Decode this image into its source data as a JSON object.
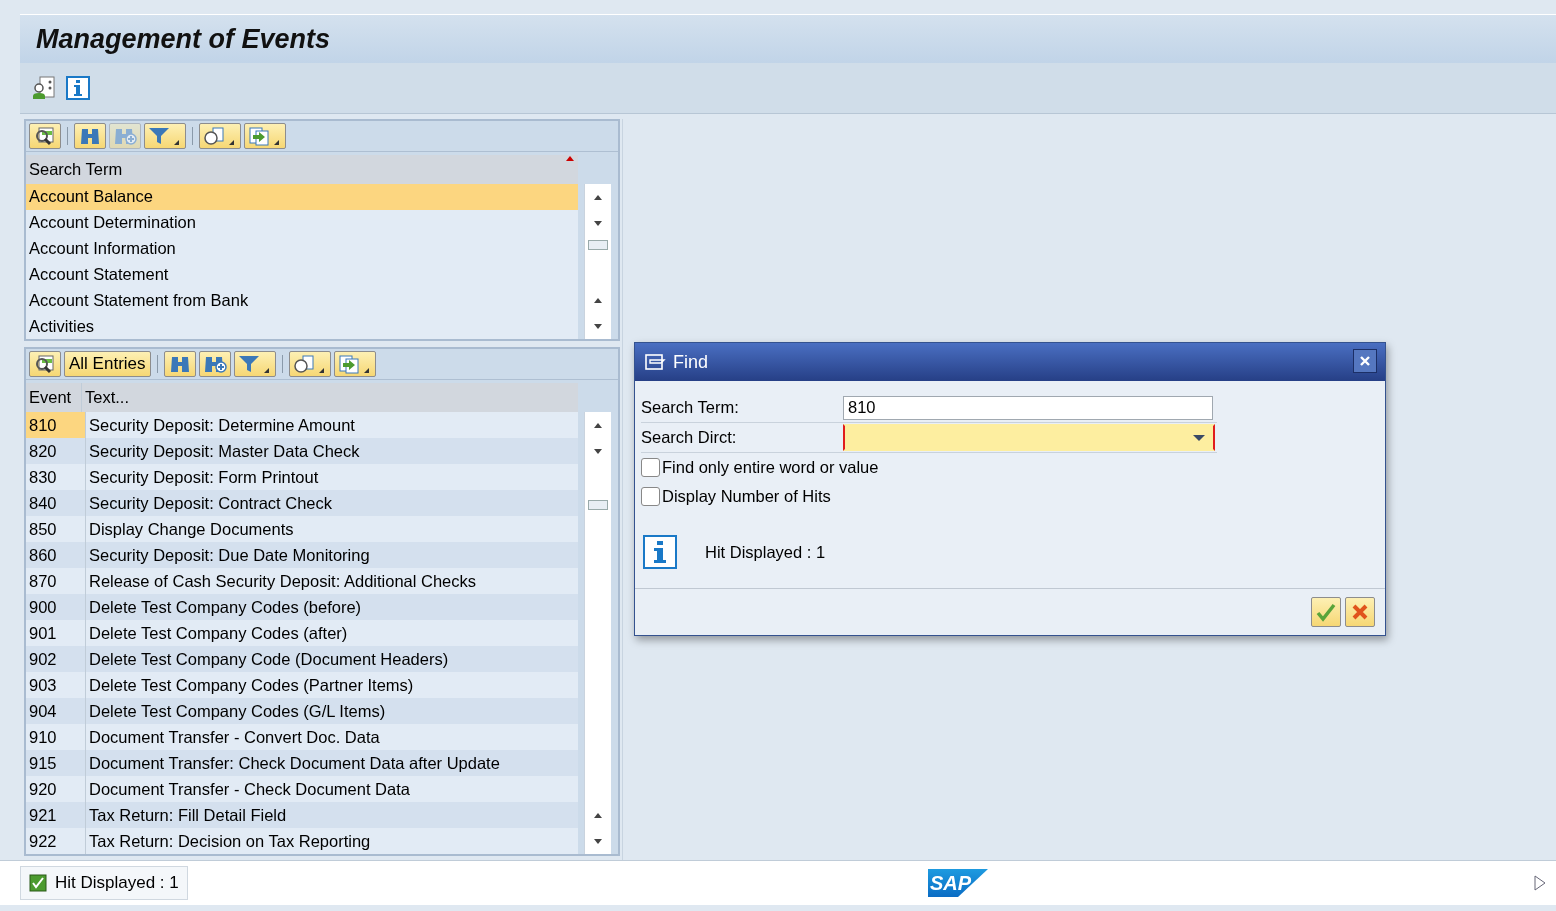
{
  "window": {
    "title": "Management of Events"
  },
  "upper_panel": {
    "toolbar": {
      "find_next_disabled": true
    },
    "column": "Search Term",
    "items": [
      {
        "label": "Account Balance",
        "selected": true
      },
      {
        "label": "Account Determination",
        "selected": false
      },
      {
        "label": "Account Information",
        "selected": false
      },
      {
        "label": "Account Statement",
        "selected": false
      },
      {
        "label": "Account Statement from Bank",
        "selected": false
      },
      {
        "label": "Activities",
        "selected": false
      }
    ]
  },
  "lower_panel": {
    "toolbar": {
      "all_entries_button": "All Entries",
      "find_next_disabled": false
    },
    "columns": [
      "Event",
      "Text..."
    ],
    "rows": [
      {
        "event": "810",
        "text": "Security Deposit: Determine Amount",
        "selected": true
      },
      {
        "event": "820",
        "text": "Security Deposit: Master Data Check",
        "selected": false
      },
      {
        "event": "830",
        "text": "Security Deposit: Form Printout",
        "selected": false
      },
      {
        "event": "840",
        "text": "Security Deposit: Contract Check",
        "selected": false
      },
      {
        "event": "850",
        "text": "Display Change Documents",
        "selected": false
      },
      {
        "event": "860",
        "text": "Security Deposit: Due Date Monitoring",
        "selected": false
      },
      {
        "event": "870",
        "text": "Release of Cash Security Deposit: Additional Checks",
        "selected": false
      },
      {
        "event": "900",
        "text": "Delete Test Company Codes (before)",
        "selected": false
      },
      {
        "event": "901",
        "text": "Delete Test Company Codes (after)",
        "selected": false
      },
      {
        "event": "902",
        "text": "Delete Test Company Code (Document Headers)",
        "selected": false
      },
      {
        "event": "903",
        "text": "Delete Test Company Codes (Partner Items)",
        "selected": false
      },
      {
        "event": "904",
        "text": "Delete Test Company Codes (G/L Items)",
        "selected": false
      },
      {
        "event": "910",
        "text": "Document Transfer - Convert Doc. Data",
        "selected": false
      },
      {
        "event": "915",
        "text": "Document Transfer: Check Document Data after Update",
        "selected": false
      },
      {
        "event": "920",
        "text": "Document Transfer - Check Document Data",
        "selected": false
      },
      {
        "event": "921",
        "text": "Tax Return: Fill Detail Field",
        "selected": false
      },
      {
        "event": "922",
        "text": "Tax Return: Decision on Tax Reporting",
        "selected": false
      }
    ]
  },
  "dialog": {
    "title": "Find",
    "search_term": {
      "label": "Search Term:",
      "value": "810"
    },
    "search_direction": {
      "label": "Search Dirct:",
      "required": true
    },
    "options": [
      {
        "label": "Find only entire word or value",
        "checked": false
      },
      {
        "label": "Display Number of Hits",
        "checked": false
      }
    ],
    "message": "Hit Displayed : 1"
  },
  "status_bar": {
    "message": "Hit Displayed : 1",
    "logo": "SAP"
  }
}
